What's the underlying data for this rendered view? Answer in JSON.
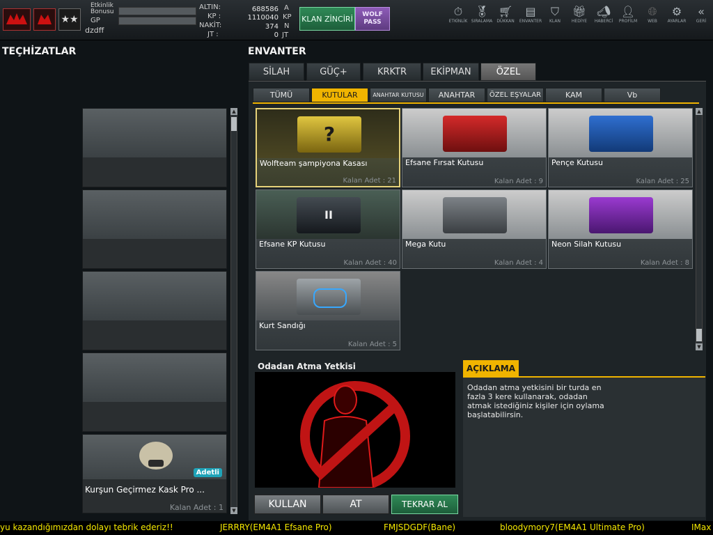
{
  "topbar": {
    "labels": {
      "etkinlik": "Etkinlik",
      "bonusu": "Bonusu",
      "gp": "GP",
      "username": "dzdff"
    },
    "currency": [
      {
        "label": "ALTIN:",
        "value": "688586",
        "unit": "A"
      },
      {
        "label": "KP :",
        "value": "1110040",
        "unit": "KP"
      },
      {
        "label": "NAKİT:",
        "value": "374",
        "unit": "N"
      },
      {
        "label": "JT :",
        "value": "0",
        "unit": "JT"
      }
    ],
    "klan_button": "KLAN ZİNCİRİ",
    "wolfpass_button_line1": "WOLF",
    "wolfpass_button_line2": "PASS",
    "menu": [
      "ETKİNLİK",
      "SIRALAMA",
      "DÜKKAN",
      "ENVANTER",
      "KLAN",
      "HEDİYE",
      "HABERCİ",
      "PROFİLM",
      "WEB",
      "AYARLAR",
      "GERİ"
    ]
  },
  "left": {
    "title": "TEÇHİZATLAR",
    "item": {
      "name": "Kurşun Geçirmez Kask Pro ...",
      "qty": "Kalan Adet : 1",
      "badge": "Adetli"
    }
  },
  "inventory": {
    "title": "ENVANTER",
    "tabs": [
      "SİLAH",
      "GÜÇ+",
      "KRKTR",
      "EKİPMAN",
      "ÖZEL"
    ],
    "subtabs": [
      "TÜMÜ",
      "KUTULAR",
      "ANAHTAR KUTUSU",
      "ANAHTAR",
      "ÖZEL EŞYALAR",
      "KAM",
      "Vb"
    ],
    "items": [
      {
        "name": "Wolfteam şampiyona Kasası",
        "qty": "Kalan Adet : 21"
      },
      {
        "name": "Efsane Fırsat Kutusu",
        "qty": "Kalan Adet : 9"
      },
      {
        "name": "Pençe Kutusu",
        "qty": "Kalan Adet : 25"
      },
      {
        "name": "Efsane KP Kutusu",
        "qty": "Kalan Adet : 40"
      },
      {
        "name": "Mega Kutu",
        "qty": "Kalan Adet : 4"
      },
      {
        "name": "Neon Silah Kutusu",
        "qty": "Kalan Adet : 8"
      },
      {
        "name": "Kurt Sandığı",
        "qty": "Kalan Adet : 5"
      }
    ]
  },
  "detail": {
    "title": "Odadan Atma Yetkisi",
    "desc_title": "AÇIKLAMA",
    "description": "Odadan atma yetkisini bir turda en fazla 3 kere kullanarak, odadan atmak istediğiniz kişiler için oylama başlatabilirsin.",
    "buttons": [
      "KULLAN",
      "AT",
      "TEKRAR AL"
    ]
  },
  "ticker": [
    "yu kazandığımızdan dolayı tebrik ederiz!!",
    "JERRRY(EM4A1 Efsane Pro)",
    "FMJSDGDF(Bane)",
    "bloodymory7(EM4A1 Ultimate Pro)",
    "IMax"
  ]
}
